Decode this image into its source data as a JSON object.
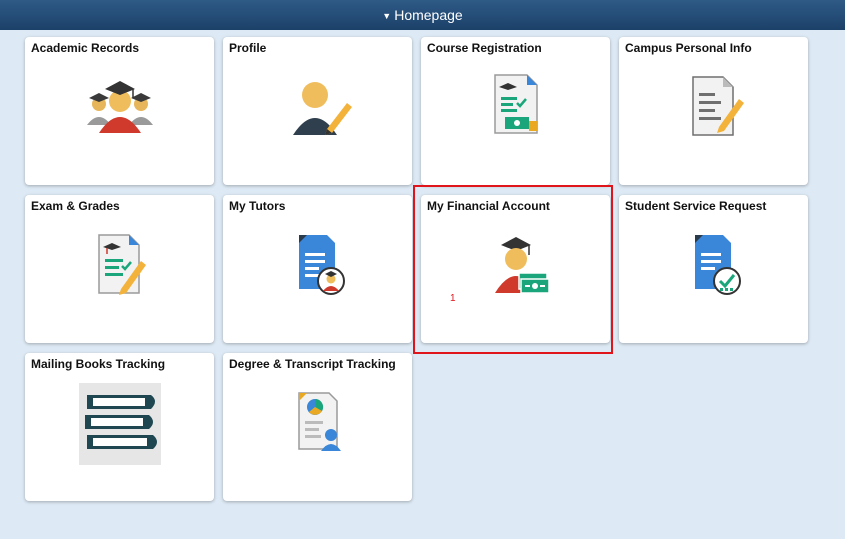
{
  "header": {
    "title": "Homepage",
    "caret": "▼"
  },
  "tiles": [
    {
      "label": "Academic Records"
    },
    {
      "label": "Profile"
    },
    {
      "label": "Course Registration"
    },
    {
      "label": "Campus Personal Info"
    },
    {
      "label": "Exam & Grades"
    },
    {
      "label": "My Tutors"
    },
    {
      "label": "My Financial Account"
    },
    {
      "label": "Student Service Request"
    },
    {
      "label": "Mailing Books Tracking"
    },
    {
      "label": "Degree & Transcript Tracking"
    }
  ],
  "annotation": {
    "label": "1",
    "color": "#e0151b"
  },
  "colors": {
    "header": "#1f4a76",
    "background": "#dde9f4",
    "accent_green": "#1aa67a",
    "accent_blue": "#3a86d8"
  }
}
